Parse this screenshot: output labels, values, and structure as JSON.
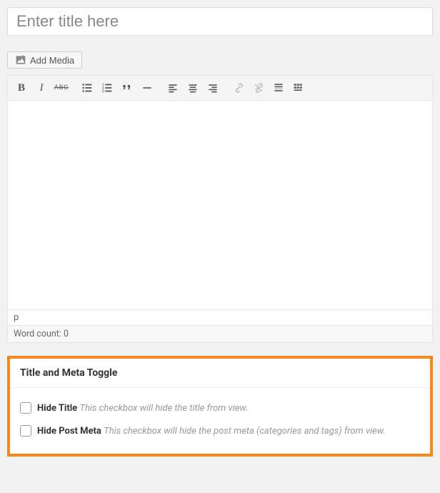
{
  "title": {
    "placeholder": "Enter title here",
    "value": ""
  },
  "media_button": {
    "label": "Add Media"
  },
  "toolbar": {
    "bold": "B",
    "italic": "I",
    "strike": "ABC",
    "quote": "❝"
  },
  "editor": {
    "path": "p",
    "word_count_label": "Word count: ",
    "word_count_value": "0"
  },
  "metabox": {
    "title": "Title and Meta Toggle",
    "options": [
      {
        "label": "Hide Title",
        "desc": "This checkbox will hide the title from view."
      },
      {
        "label": "Hide Post Meta",
        "desc": "This checkbox will hide the post meta (categories and tags) from view."
      }
    ]
  }
}
